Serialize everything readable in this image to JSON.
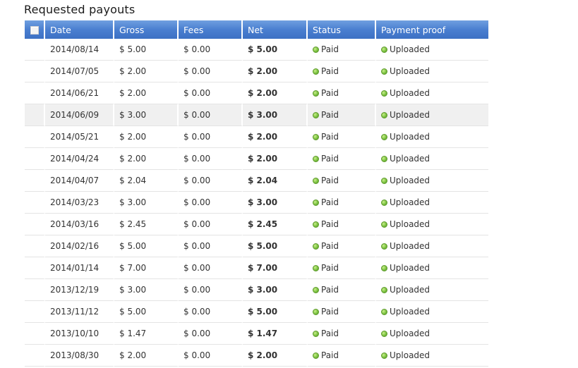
{
  "page_title": "Requested payouts",
  "columns": {
    "date": "Date",
    "gross": "Gross",
    "fees": "Fees",
    "net": "Net",
    "status": "Status",
    "payment_proof": "Payment proof"
  },
  "status_color": "#7cc242",
  "header_color": "#4a7fd0",
  "rows": [
    {
      "date": "2014/08/14",
      "gross": "$ 5.00",
      "fees": "$ 0.00",
      "net": "$ 5.00",
      "status": "Paid",
      "proof": "Uploaded"
    },
    {
      "date": "2014/07/05",
      "gross": "$ 2.00",
      "fees": "$ 0.00",
      "net": "$ 2.00",
      "status": "Paid",
      "proof": "Uploaded"
    },
    {
      "date": "2014/06/21",
      "gross": "$ 2.00",
      "fees": "$ 0.00",
      "net": "$ 2.00",
      "status": "Paid",
      "proof": "Uploaded"
    },
    {
      "date": "2014/06/09",
      "gross": "$ 3.00",
      "fees": "$ 0.00",
      "net": "$ 3.00",
      "status": "Paid",
      "proof": "Uploaded"
    },
    {
      "date": "2014/05/21",
      "gross": "$ 2.00",
      "fees": "$ 0.00",
      "net": "$ 2.00",
      "status": "Paid",
      "proof": "Uploaded"
    },
    {
      "date": "2014/04/24",
      "gross": "$ 2.00",
      "fees": "$ 0.00",
      "net": "$ 2.00",
      "status": "Paid",
      "proof": "Uploaded"
    },
    {
      "date": "2014/04/07",
      "gross": "$ 2.04",
      "fees": "$ 0.00",
      "net": "$ 2.04",
      "status": "Paid",
      "proof": "Uploaded"
    },
    {
      "date": "2014/03/23",
      "gross": "$ 3.00",
      "fees": "$ 0.00",
      "net": "$ 3.00",
      "status": "Paid",
      "proof": "Uploaded"
    },
    {
      "date": "2014/03/16",
      "gross": "$ 2.45",
      "fees": "$ 0.00",
      "net": "$ 2.45",
      "status": "Paid",
      "proof": "Uploaded"
    },
    {
      "date": "2014/02/16",
      "gross": "$ 5.00",
      "fees": "$ 0.00",
      "net": "$ 5.00",
      "status": "Paid",
      "proof": "Uploaded"
    },
    {
      "date": "2014/01/14",
      "gross": "$ 7.00",
      "fees": "$ 0.00",
      "net": "$ 7.00",
      "status": "Paid",
      "proof": "Uploaded"
    },
    {
      "date": "2013/12/19",
      "gross": "$ 3.00",
      "fees": "$ 0.00",
      "net": "$ 3.00",
      "status": "Paid",
      "proof": "Uploaded"
    },
    {
      "date": "2013/11/12",
      "gross": "$ 5.00",
      "fees": "$ 0.00",
      "net": "$ 5.00",
      "status": "Paid",
      "proof": "Uploaded"
    },
    {
      "date": "2013/10/10",
      "gross": "$ 1.47",
      "fees": "$ 0.00",
      "net": "$ 1.47",
      "status": "Paid",
      "proof": "Uploaded"
    },
    {
      "date": "2013/08/30",
      "gross": "$ 2.00",
      "fees": "$ 0.00",
      "net": "$ 2.00",
      "status": "Paid",
      "proof": "Uploaded"
    }
  ]
}
